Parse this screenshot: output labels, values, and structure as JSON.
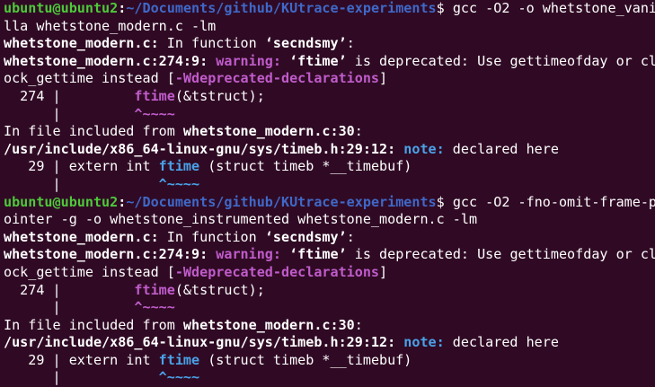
{
  "terminal": {
    "colors": {
      "background": "#300a24",
      "foreground": "#ffffff",
      "prompt_user": "#4ec93b",
      "prompt_path": "#3f68c8",
      "warning": "#c05ccb",
      "note": "#4aa2e8"
    },
    "lines": [
      [
        {
          "t": "ubuntu@ubuntu2",
          "c": "green b"
        },
        {
          "t": ":",
          "c": "white b"
        },
        {
          "t": "~/Documents/github/KUtrace-experiments",
          "c": "blue b"
        },
        {
          "t": "$ gcc -O2 -o whetstone_vani",
          "c": "white"
        }
      ],
      [
        {
          "t": "lla whetstone_modern.c -lm",
          "c": "white"
        }
      ],
      [
        {
          "t": "whetstone_modern.c:",
          "c": "white b"
        },
        {
          "t": " In function ",
          "c": "white"
        },
        {
          "t": "‘secndsmy’",
          "c": "white b"
        },
        {
          "t": ":",
          "c": "white"
        }
      ],
      [
        {
          "t": "whetstone_modern.c:274:9:",
          "c": "white b"
        },
        {
          "t": " ",
          "c": "white"
        },
        {
          "t": "warning:",
          "c": "magenta b"
        },
        {
          "t": " ",
          "c": "white"
        },
        {
          "t": "‘ftime’",
          "c": "white b"
        },
        {
          "t": " is deprecated: Use gettimeofday or cl",
          "c": "white"
        }
      ],
      [
        {
          "t": "ock_gettime instead [",
          "c": "white"
        },
        {
          "t": "-Wdeprecated-declarations",
          "c": "magenta b"
        },
        {
          "t": "]",
          "c": "white"
        }
      ],
      [
        {
          "t": "  274 |         ",
          "c": "white"
        },
        {
          "t": "ftime",
          "c": "magenta b"
        },
        {
          "t": "(&tstruct);",
          "c": "white"
        }
      ],
      [
        {
          "t": "      |         ",
          "c": "white"
        },
        {
          "t": "^~~~~",
          "c": "magenta b"
        }
      ],
      [
        {
          "t": "In file included from ",
          "c": "white"
        },
        {
          "t": "whetstone_modern.c:30",
          "c": "white b"
        },
        {
          "t": ":",
          "c": "white"
        }
      ],
      [
        {
          "t": "/usr/include/x86_64-linux-gnu/sys/timeb.h:29:12:",
          "c": "white b"
        },
        {
          "t": " ",
          "c": "white"
        },
        {
          "t": "note:",
          "c": "cyan b"
        },
        {
          "t": " declared here",
          "c": "white"
        }
      ],
      [
        {
          "t": "   29 | extern int ",
          "c": "white"
        },
        {
          "t": "ftime",
          "c": "cyan b"
        },
        {
          "t": " (struct timeb *__timebuf)",
          "c": "white"
        }
      ],
      [
        {
          "t": "      |            ",
          "c": "white"
        },
        {
          "t": "^~~~~",
          "c": "cyan b"
        }
      ],
      [
        {
          "t": "ubuntu@ubuntu2",
          "c": "green b"
        },
        {
          "t": ":",
          "c": "white b"
        },
        {
          "t": "~/Documents/github/KUtrace-experiments",
          "c": "blue b"
        },
        {
          "t": "$ gcc -O2 -fno-omit-frame-p",
          "c": "white"
        }
      ],
      [
        {
          "t": "ointer -g -o whetstone_instrumented whetstone_modern.c -lm",
          "c": "white"
        }
      ],
      [
        {
          "t": "whetstone_modern.c:",
          "c": "white b"
        },
        {
          "t": " In function ",
          "c": "white"
        },
        {
          "t": "‘secndsmy’",
          "c": "white b"
        },
        {
          "t": ":",
          "c": "white"
        }
      ],
      [
        {
          "t": "whetstone_modern.c:274:9:",
          "c": "white b"
        },
        {
          "t": " ",
          "c": "white"
        },
        {
          "t": "warning:",
          "c": "magenta b"
        },
        {
          "t": " ",
          "c": "white"
        },
        {
          "t": "‘ftime’",
          "c": "white b"
        },
        {
          "t": " is deprecated: Use gettimeofday or cl",
          "c": "white"
        }
      ],
      [
        {
          "t": "ock_gettime instead [",
          "c": "white"
        },
        {
          "t": "-Wdeprecated-declarations",
          "c": "magenta b"
        },
        {
          "t": "]",
          "c": "white"
        }
      ],
      [
        {
          "t": "  274 |         ",
          "c": "white"
        },
        {
          "t": "ftime",
          "c": "magenta b"
        },
        {
          "t": "(&tstruct);",
          "c": "white"
        }
      ],
      [
        {
          "t": "      |         ",
          "c": "white"
        },
        {
          "t": "^~~~~",
          "c": "magenta b"
        }
      ],
      [
        {
          "t": "In file included from ",
          "c": "white"
        },
        {
          "t": "whetstone_modern.c:30",
          "c": "white b"
        },
        {
          "t": ":",
          "c": "white"
        }
      ],
      [
        {
          "t": "/usr/include/x86_64-linux-gnu/sys/timeb.h:29:12:",
          "c": "white b"
        },
        {
          "t": " ",
          "c": "white"
        },
        {
          "t": "note:",
          "c": "cyan b"
        },
        {
          "t": " declared here",
          "c": "white"
        }
      ],
      [
        {
          "t": "   29 | extern int ",
          "c": "white"
        },
        {
          "t": "ftime",
          "c": "cyan b"
        },
        {
          "t": " (struct timeb *__timebuf)",
          "c": "white"
        }
      ],
      [
        {
          "t": "      |            ",
          "c": "white"
        },
        {
          "t": "^~~~~",
          "c": "cyan b"
        }
      ]
    ]
  }
}
